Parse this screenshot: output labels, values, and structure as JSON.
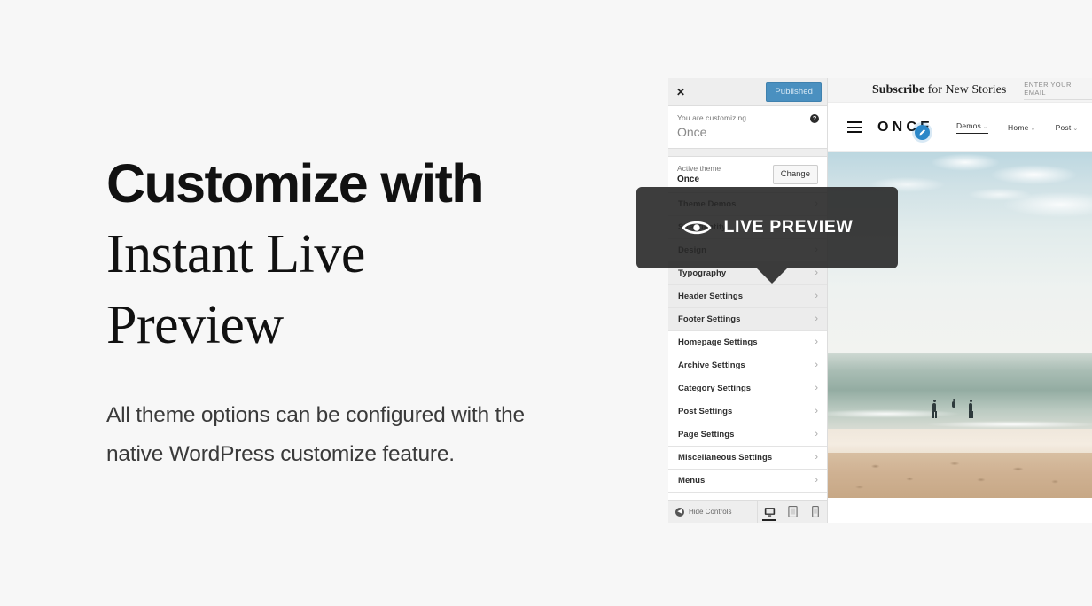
{
  "marketing": {
    "headline_line1": "Customize with",
    "headline_line2": "Instant Live",
    "headline_line3": "Preview",
    "subcopy": "All theme options can be configured with the native WordPress customize feature."
  },
  "callout": {
    "label": "LIVE PREVIEW",
    "icon": "eye-icon",
    "background": "#282828"
  },
  "customizer": {
    "close_label": "✕",
    "publish_label": "Published",
    "publish_color": "#4a90c0",
    "kicker": "You are customizing",
    "site_name": "Once",
    "help_label": "?",
    "active_theme_label": "Active theme",
    "active_theme_name": "Once",
    "change_label": "Change",
    "items": [
      {
        "label": "Theme Demos",
        "chevron": "›"
      },
      {
        "label": "Site Identity",
        "chevron": "›"
      },
      {
        "label": "Design",
        "chevron": "›"
      },
      {
        "label": "Typography",
        "chevron": "›"
      },
      {
        "label": "Header Settings",
        "chevron": "›"
      },
      {
        "label": "Footer Settings",
        "chevron": "›"
      },
      {
        "label": "Homepage Settings",
        "chevron": "›"
      },
      {
        "label": "Archive Settings",
        "chevron": "›"
      },
      {
        "label": "Category Settings",
        "chevron": "›"
      },
      {
        "label": "Post Settings",
        "chevron": "›"
      },
      {
        "label": "Page Settings",
        "chevron": "›"
      },
      {
        "label": "Miscellaneous Settings",
        "chevron": "›"
      },
      {
        "label": "Menus",
        "chevron": "›"
      }
    ],
    "footer": {
      "hide_controls_label": "Hide Controls",
      "hide_controls_icon": "chevron-left-icon",
      "devices": [
        {
          "name": "desktop-icon",
          "active": true
        },
        {
          "name": "tablet-icon",
          "active": false
        },
        {
          "name": "mobile-icon",
          "active": false
        }
      ]
    }
  },
  "preview": {
    "subscribe_bold": "Subscribe",
    "subscribe_rest": " for New Stories",
    "email_placeholder": "ENTER YOUR EMAIL",
    "logo": "ONCE",
    "edit_icon": "pencil-edit-icon",
    "edit_color": "#2b87c8",
    "menu": [
      {
        "label": "Demos",
        "caret": "⌄",
        "active": true
      },
      {
        "label": "Home",
        "caret": "⌄",
        "active": false
      },
      {
        "label": "Post",
        "caret": "⌄",
        "active": false
      }
    ],
    "hero_alt": "beach-photo"
  }
}
